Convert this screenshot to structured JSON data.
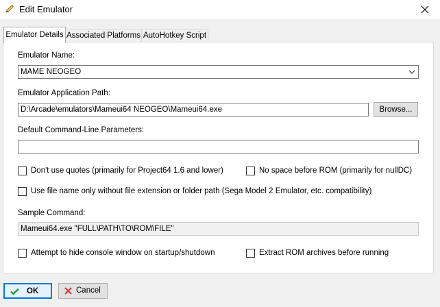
{
  "window": {
    "title": "Edit Emulator",
    "icon": "pencil-icon",
    "close_icon": "close-icon"
  },
  "tabs": [
    {
      "label": "Emulator Details",
      "active": true
    },
    {
      "label": "Associated Platforms",
      "active": false
    },
    {
      "label": "AutoHotkey Script",
      "active": false
    }
  ],
  "form": {
    "name_label": "Emulator Name:",
    "name_value": "MAME NEOGEO",
    "path_label": "Emulator Application Path:",
    "path_value": "D:\\Arcade\\emulators\\Mameui64 NEOGEO\\Mameui64.exe",
    "browse_label": "Browse...",
    "params_label": "Default Command-Line Parameters:",
    "params_value": "",
    "cb_no_quotes": "Don't use quotes (primarily for Project64 1.6 and lower)",
    "cb_no_space": "No space before ROM (primarily for nullDC)",
    "cb_filename_only": "Use file name only without file extension or folder path (Sega Model 2 Emulator, etc. compatibility)",
    "sample_label": "Sample Command:",
    "sample_value": "Mameui64.exe \"FULL\\PATH\\TO\\ROM\\FILE\"",
    "cb_hide_console": "Attempt to hide console window on startup/shutdown",
    "cb_extract_rom": "Extract ROM archives before running"
  },
  "footer": {
    "ok_label": "OK",
    "cancel_label": "Cancel"
  },
  "colors": {
    "accent": "#0078d7",
    "ok_check": "#1e9e3a",
    "cancel_x": "#d83b3b"
  }
}
